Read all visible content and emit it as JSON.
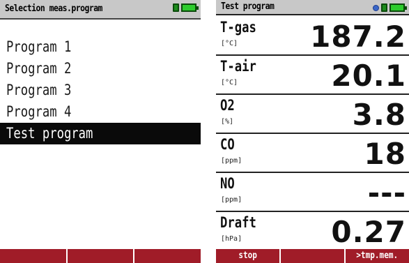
{
  "left": {
    "title": "Selection meas.program",
    "menu_items": [
      {
        "label": "Program 1",
        "selected": false
      },
      {
        "label": "Program 2",
        "selected": false
      },
      {
        "label": "Program 3",
        "selected": false
      },
      {
        "label": "Program 4",
        "selected": false
      },
      {
        "label": "Test program",
        "selected": true
      }
    ],
    "softkeys": [
      "",
      "",
      ""
    ]
  },
  "right": {
    "title": "Test program",
    "measurements": [
      {
        "name": "T-gas",
        "unit": "[°C]",
        "value": "187.2"
      },
      {
        "name": "T-air",
        "unit": "[°C]",
        "value": "20.1"
      },
      {
        "name": "O2",
        "unit": "[%]",
        "value": "3.8"
      },
      {
        "name": "CO",
        "unit": "[ppm]",
        "value": "18"
      },
      {
        "name": "NO",
        "unit": "[ppm]",
        "value": "---"
      },
      {
        "name": "Draft",
        "unit": "[hPa]",
        "value": "0.27"
      }
    ],
    "softkeys": [
      "stop",
      "",
      ">tmp.mem."
    ]
  },
  "icons": {
    "status_dot": "info-dot-icon",
    "lock": "lock-icon",
    "battery": "battery-icon"
  },
  "colors": {
    "softkey_bar": "#a01c28",
    "titlebar": "#c8c8c8",
    "battery_fill": "#2ecc2e",
    "selection": "#0a0a0a"
  }
}
